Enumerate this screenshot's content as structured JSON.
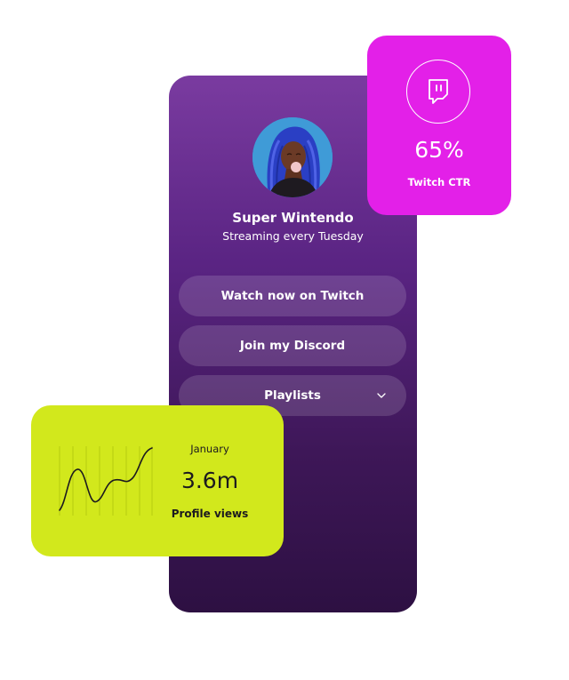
{
  "profile": {
    "name": "Super Wintendo",
    "tagline": "Streaming every Tuesday"
  },
  "links": {
    "twitch_label": "Watch now on Twitch",
    "discord_label": "Join my Discord",
    "playlists_label": "Playlists"
  },
  "twitch_stat": {
    "value": "65%",
    "label": "Twitch CTR",
    "icon": "twitch-icon"
  },
  "views_stat": {
    "month": "January",
    "value": "3.6m",
    "label": "Profile views"
  },
  "colors": {
    "phone_top": "#7a3ba0",
    "phone_bottom": "#2d1042",
    "twitch_card": "#e320e8",
    "views_card": "#d2e81c"
  }
}
